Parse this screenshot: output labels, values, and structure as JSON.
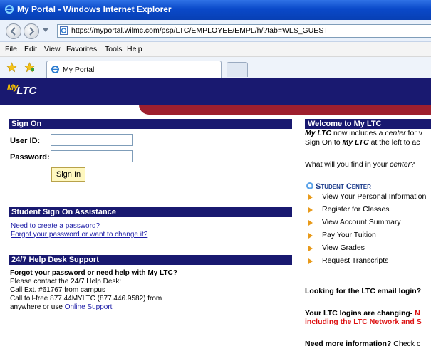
{
  "window": {
    "title": "My Portal - Windows Internet Explorer"
  },
  "address": {
    "url": "https://myportal.wilmc.com/psp/LTC/EMPLOYEE/EMPL/h/?tab=WLS_GUEST"
  },
  "menu": [
    "File",
    "Edit",
    "View",
    "Favorites",
    "Tools",
    "Help"
  ],
  "tab": {
    "label": "My Portal"
  },
  "logo": {
    "my": "My",
    "ltc": "LTC"
  },
  "signon": {
    "header": "Sign On",
    "userid_label": "User ID:",
    "password_label": "Password:",
    "userid_value": "",
    "password_value": "",
    "button": "Sign In"
  },
  "assist": {
    "header": "Student Sign On Assistance",
    "link1": "Need to create a password?",
    "link2": "Forgot your password or want to change it?"
  },
  "help": {
    "header": "24/7 Help Desk Support",
    "bold": "Forgot your password or need help with My LTC?",
    "line1": "Please contact the 24/7 Help Desk:",
    "line2": "Call Ext. #61767 from campus",
    "line3": "Call toll-free 877.44MYLTC (877.446.9582) from",
    "line4": "anywhere or use",
    "link": "Online Support"
  },
  "welcome": {
    "header": "Welcome to My LTC",
    "p1a": "My LTC",
    "p1b": " now includes a ",
    "p1c": "center",
    "p1d": " for v",
    "p2a": "Sign On to ",
    "p2b": "My LTC",
    "p2c": " at the left to ac",
    "q": "What will you find in your ",
    "q_em": "center",
    "q_end": "?",
    "student_center": "Student Center",
    "items": [
      "View Your Personal Information",
      "Register for Classes",
      "View Account Summary",
      "Pay Your Tuition",
      "View Grades",
      "Request Transcripts"
    ],
    "email_q": "Looking for the LTC email login?",
    "changing1a": "Your LTC logins are changing- ",
    "changing1b": "N",
    "changing2": "including the LTC Network and S",
    "more_a": "Need more information?",
    "more_b": " Check c"
  }
}
